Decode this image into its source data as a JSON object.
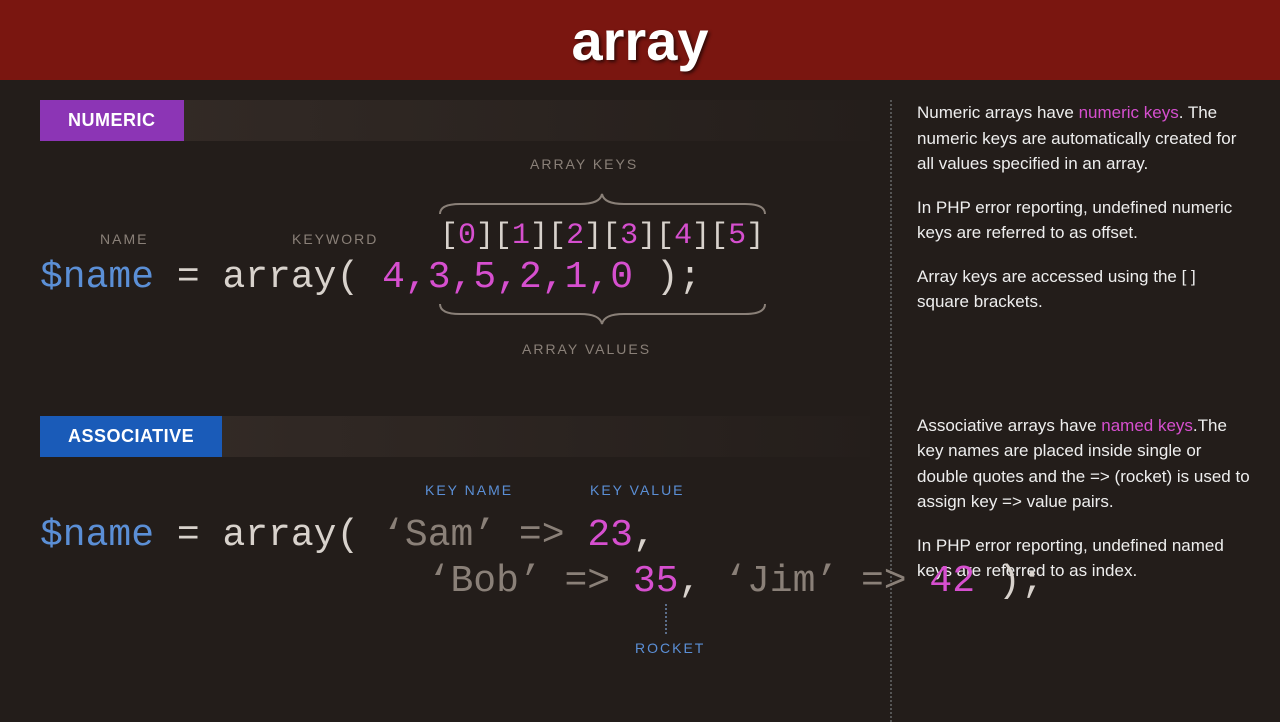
{
  "header": {
    "title": "array"
  },
  "numeric": {
    "badge": "NUMERIC",
    "labels": {
      "array_keys": "ARRAY KEYS",
      "name": "NAME",
      "keyword": "KEYWORD",
      "array_values": "ARRAY VALUES"
    },
    "keys": [
      "0",
      "1",
      "2",
      "3",
      "4",
      "5"
    ],
    "code": {
      "var": "$name",
      "eq": " = ",
      "kw": "array",
      "open": "( ",
      "values": [
        "4",
        "3",
        "5",
        "2",
        "1",
        "0"
      ],
      "close": " );"
    }
  },
  "assoc": {
    "badge": "ASSOCIATIVE",
    "labels": {
      "key_name": "KEY NAME",
      "key_value": "KEY VALUE",
      "rocket": "ROCKET"
    },
    "code": {
      "var": "$name",
      "eq": " = ",
      "kw": "array",
      "open": "( ",
      "pairs": [
        {
          "key": "‘Sam’",
          "rocket": " => ",
          "value": "23"
        },
        {
          "key": "‘Bob’",
          "rocket": " => ",
          "value": "35"
        },
        {
          "key": "‘Jim’",
          "rocket": " => ",
          "value": "42"
        }
      ],
      "comma": ",",
      "close": " );",
      "indent": "                 "
    }
  },
  "sidebar": {
    "numeric": {
      "p1a": "Numeric arrays have ",
      "p1b": "numeric keys",
      "p1c": ". The numeric keys are automatically created for all values specified in an array.",
      "p2": "In PHP error reporting, undefined numeric keys are referred to as offset.",
      "p3": "Array keys are accessed using the [  ] square brackets."
    },
    "assoc": {
      "p1a": "Associative arrays have ",
      "p1b": "named keys",
      "p1c": ".The key names are placed inside single or double quotes and the => (rocket) is used to assign key => value pairs.",
      "p2": "In PHP error reporting, undefined named keys are referred to as index."
    }
  }
}
